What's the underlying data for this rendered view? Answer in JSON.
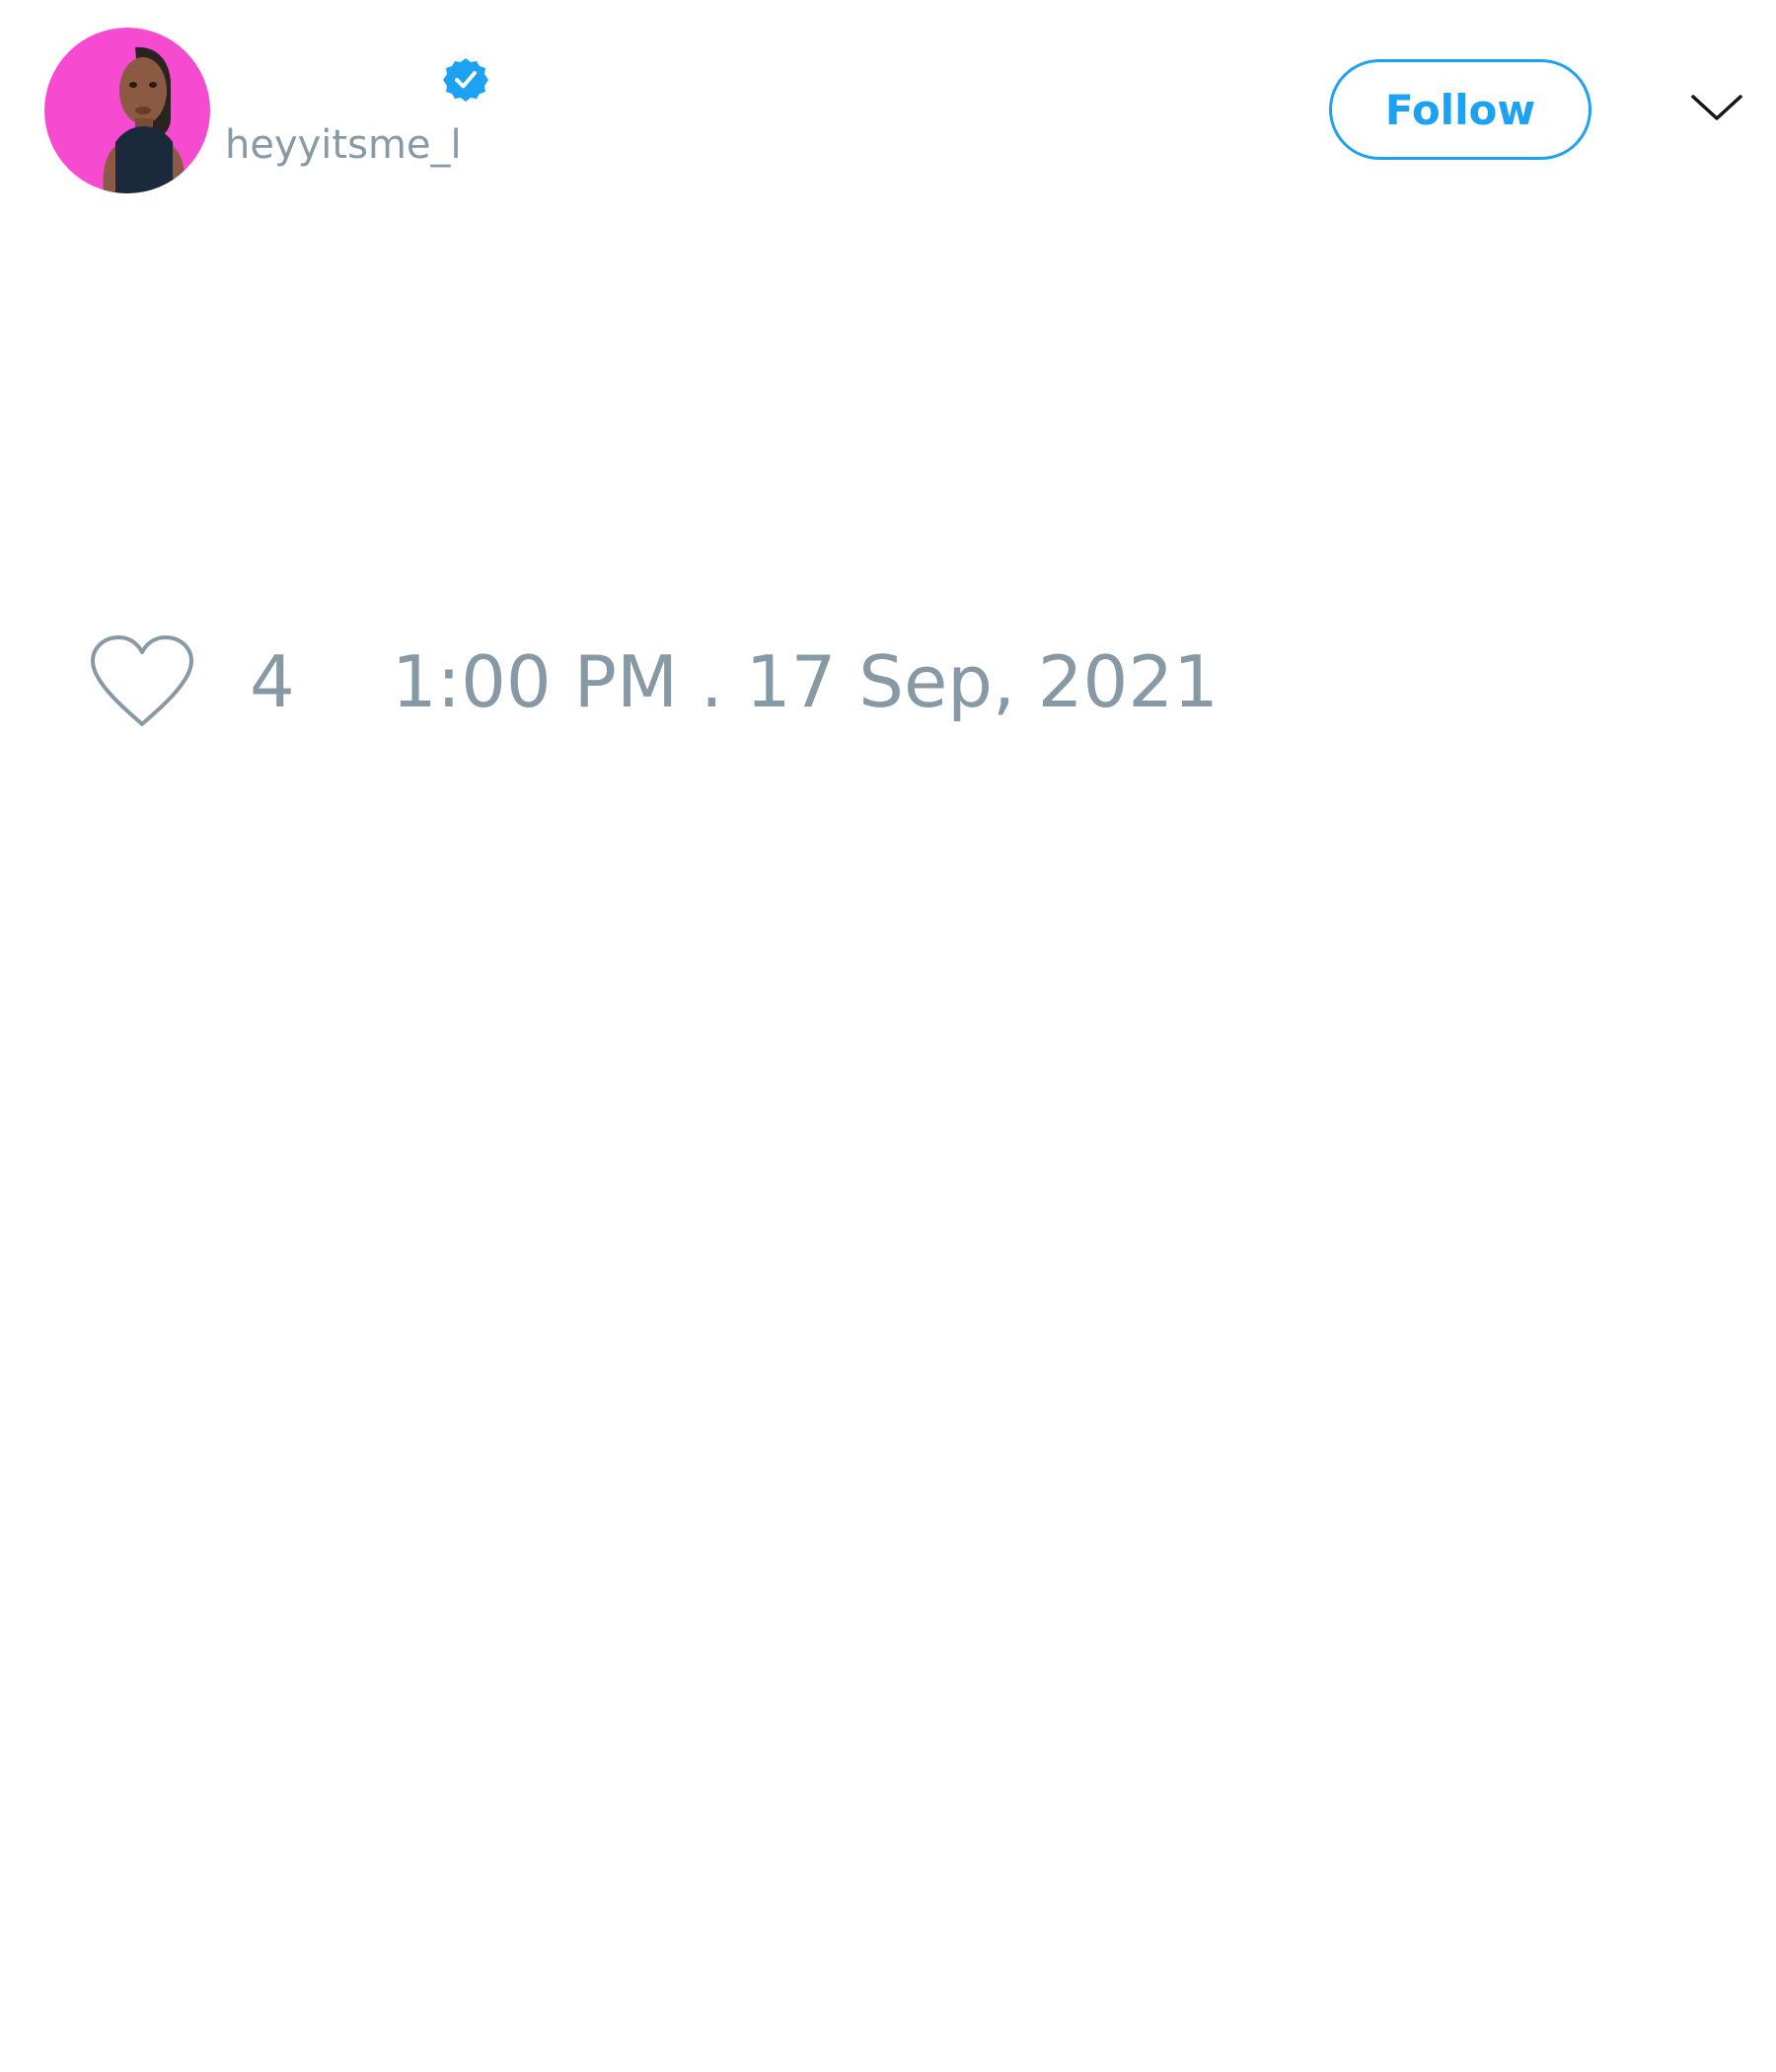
{
  "tweet": {
    "author": {
      "display_name": "",
      "username": "heyyitsme_l",
      "verified": true
    },
    "follow_button": {
      "label": "Follow"
    },
    "menu_icon": "chevron-down-icon",
    "likes": {
      "icon": "heart-icon",
      "count": "4"
    },
    "timestamp": "1:00 PM . 17 Sep, 2021"
  },
  "colors": {
    "accent": "#1da1f2",
    "muted_text": "#8899a6",
    "avatar_background": "#f64bd1",
    "verified_badge": "#1da1f2"
  }
}
